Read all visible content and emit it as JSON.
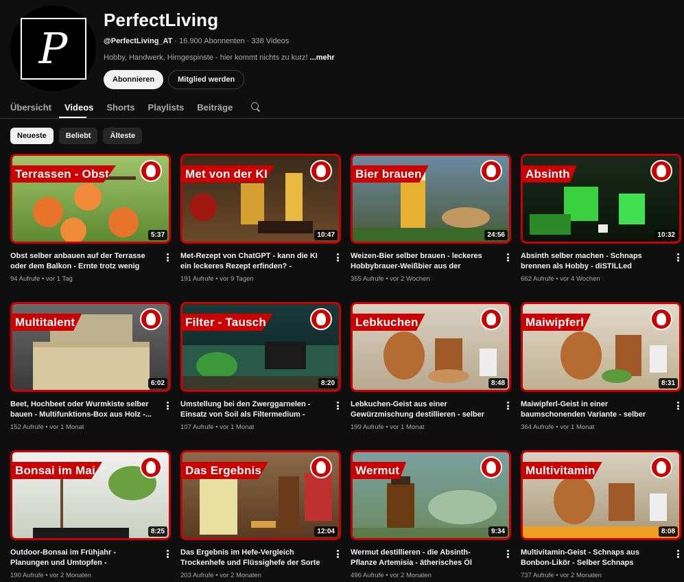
{
  "channel": {
    "name": "PerfectLiving",
    "handle": "@PerfectLiving_AT",
    "stats": " · 16.900 Abonnenten · 338 Videos",
    "description": "Hobby, Handwerk, Hirngespinste - hier kommt nichts zu kurz! ",
    "more_label": "...mehr",
    "avatar_glyph": "P",
    "subscribe_label": "Abonnieren",
    "member_label": "Mitglied werden"
  },
  "tabs": [
    {
      "label": "Übersicht"
    },
    {
      "label": "Videos"
    },
    {
      "label": "Shorts"
    },
    {
      "label": "Playlists"
    },
    {
      "label": "Beiträge"
    }
  ],
  "active_tab": "Videos",
  "chips": [
    {
      "label": "Neueste"
    },
    {
      "label": "Beliebt"
    },
    {
      "label": "Älteste"
    }
  ],
  "colors": {
    "accent": "#cc0000",
    "background": "#0f0f0f"
  },
  "videos": [
    {
      "ribbon": "Terrassen - Obst",
      "duration": "5:37",
      "title": "Obst selber anbauen auf der Terrasse oder dem Balkon - Ernte trotz wenig Platz -...",
      "meta": "94 Aufrufe • vor 1 Tag",
      "badge_icon": "tree-icon"
    },
    {
      "ribbon": "Met von der KI",
      "duration": "10:47",
      "title": "Met-Rezept von ChatGPT - kann die KI ein leckeres Rezept erfinden? - Fermentastisch",
      "meta": "191 Aufrufe • vor 9 Tagen",
      "badge_icon": "flask-icon"
    },
    {
      "ribbon": "Bier brauen",
      "duration": "24:56",
      "title": "Weizen-Bier selber brauen - leckeres Hobbybrauer-Weißbier aus der eigenen...",
      "meta": "355 Aufrufe • vor 2 Wochen",
      "badge_icon": "flask-icon"
    },
    {
      "ribbon": "Absinth",
      "duration": "10:32",
      "title": "Absinth selber machen - Schnaps brennen als Hobby - diSTILLed",
      "meta": "662 Aufrufe • vor 4 Wochen",
      "badge_icon": "still-icon"
    },
    {
      "ribbon": "Multitalent",
      "duration": "6:02",
      "title": "Beet, Hochbeet oder Wurmkiste selber bauen - Multifunktions-Box aus Holz -...",
      "meta": "152 Aufrufe • vor 1 Monat",
      "badge_icon": "tree-icon"
    },
    {
      "ribbon": "Filter - Tausch",
      "duration": "8:20",
      "title": "Umstellung bei den Zwerggarnelen - Einsatz von Soil als Filtermedium - Aquaristik",
      "meta": "107 Aufrufe • vor 1 Monat",
      "badge_icon": "fish-icon"
    },
    {
      "ribbon": "Lebkuchen",
      "duration": "8:48",
      "title": "Lebkuchen-Geist aus einer Gewürzmischung destillieren - selber Schnaps brennen als...",
      "meta": "199 Aufrufe • vor 1 Monat",
      "badge_icon": "still-icon"
    },
    {
      "ribbon": "Maiwipferl",
      "duration": "8:31",
      "title": "Maiwipferl-Geist in einer baumschonenden Variante - selber Schnaps brennen als Hob...",
      "meta": "364 Aufrufe • vor 1 Monat",
      "badge_icon": "still-icon"
    },
    {
      "ribbon": "Bonsai im Mai",
      "duration": "8:25",
      "title": "Outdoor-Bonsai im Frühjahr - Planungen und Umtopfen - Großstadtgärtnern",
      "meta": "190 Aufrufe • vor 2 Monaten",
      "badge_icon": "tree-icon"
    },
    {
      "ribbon": "Das Ergebnis",
      "duration": "12:04",
      "title": "Das Ergebnis im Hefe-Vergleich Trockenhefe und Flüssighefe der Sorte Steinberg -...",
      "meta": "203 Aufrufe • vor 2 Monaten",
      "badge_icon": "flask-icon"
    },
    {
      "ribbon": "Wermut",
      "duration": "9:34",
      "title": "Wermut destillieren - die Absinth-Pflanze Artemisia - ätherisches Öl selber machen -...",
      "meta": "496 Aufrufe • vor 2 Monaten",
      "badge_icon": "still-icon"
    },
    {
      "ribbon": "Multivitamin",
      "duration": "8:08",
      "title": "Multivitamin-Geist - Schnaps aus Bonbon-Likör - Selber Schnaps brennen als Hobby -...",
      "meta": "737 Aufrufe • vor 2 Monaten",
      "badge_icon": "still-icon"
    }
  ]
}
